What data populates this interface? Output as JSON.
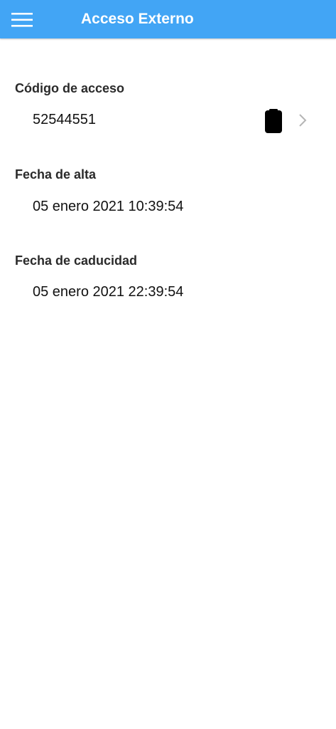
{
  "header": {
    "title": "Acceso Externo",
    "menu_icon": "hamburger-menu-icon",
    "color": "#42a5f5"
  },
  "fields": {
    "access_code": {
      "label": "Código de acceso",
      "value": "52544551",
      "copy_icon": "clipboard-icon",
      "detail_icon": "chevron-right-icon"
    },
    "start_date": {
      "label": "Fecha de alta",
      "value": "05 enero 2021 10:39:54"
    },
    "expiry_date": {
      "label": "Fecha de caducidad",
      "value": "05 enero 2021 22:39:54"
    }
  }
}
